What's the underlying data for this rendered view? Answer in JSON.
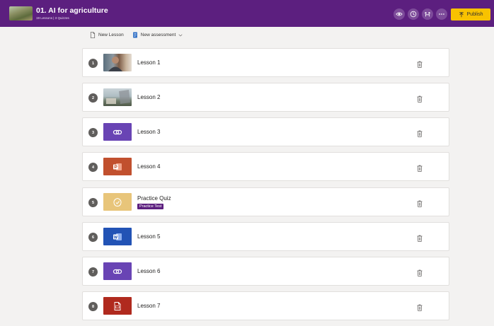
{
  "header": {
    "title": "01. AI for agriculture",
    "subtitle": "19 Lessons | 3 Quizzes",
    "publish_label": "Publish",
    "icons": [
      "eye-icon",
      "clock-icon",
      "share-icon",
      "more-icon"
    ],
    "color": "#5c1f7f",
    "publish_color": "#f8c200"
  },
  "toolbar": {
    "new_lesson": "New Lesson",
    "new_assessment": "New assessment"
  },
  "lessons": [
    {
      "number": "1",
      "label": "Lesson 1",
      "type": "video-person",
      "icon": "video-thumbnail"
    },
    {
      "number": "2",
      "label": "Lesson 2",
      "type": "video-scene",
      "icon": "video-thumbnail"
    },
    {
      "number": "3",
      "label": "Lesson 3",
      "type": "link",
      "color": "#6944b4",
      "icon": "link-icon"
    },
    {
      "number": "4",
      "label": "Lesson 4",
      "type": "powerpoint",
      "color": "#c1502e",
      "icon": "powerpoint-icon"
    },
    {
      "number": "5",
      "label": "Practice Quiz",
      "badge": "Practice Test",
      "type": "quiz",
      "color": "#e8c57a",
      "icon": "quiz-icon"
    },
    {
      "number": "6",
      "label": "Lesson 5",
      "type": "word",
      "color": "#2253b5",
      "icon": "word-icon"
    },
    {
      "number": "7",
      "label": "Lesson 6",
      "type": "link",
      "color": "#6944b4",
      "icon": "link-icon"
    },
    {
      "number": "8",
      "label": "Lesson 7",
      "type": "pdf",
      "color": "#b02a1e",
      "icon": "pdf-icon"
    }
  ]
}
